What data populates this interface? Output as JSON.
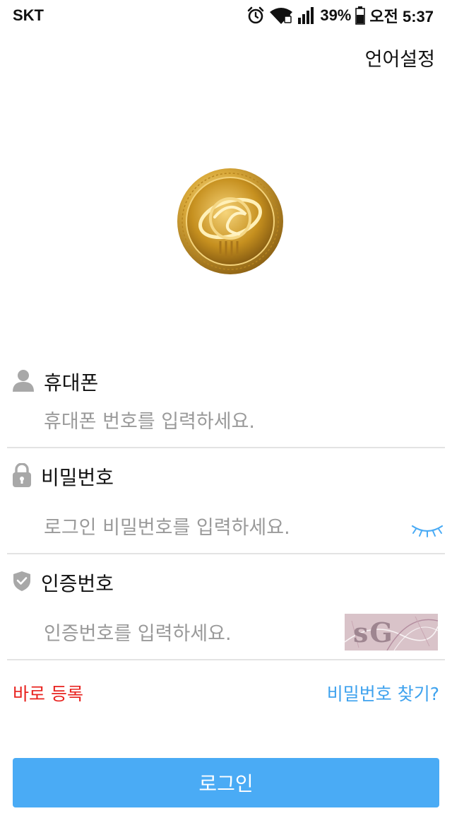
{
  "status_bar": {
    "carrier": "SKT",
    "battery": "39%",
    "time": "오전 5:37",
    "icons": [
      "alarm-icon",
      "wifi-icon",
      "signal-icon",
      "battery-icon"
    ]
  },
  "header": {
    "language_link": "언어설정"
  },
  "logo": {
    "icon": "vpay-coin-logo"
  },
  "form": {
    "phone": {
      "label": "휴대폰",
      "placeholder": "휴대폰 번호를 입력하세요.",
      "value": "",
      "icon": "person-icon"
    },
    "password": {
      "label": "비밀번호",
      "placeholder": "로그인 비밀번호를 입력하세요.",
      "value": "",
      "icon": "lock-icon",
      "toggle_icon": "closed-eye-icon"
    },
    "captcha": {
      "label": "인증번호",
      "placeholder": "인증번호를 입력하세요.",
      "value": "",
      "icon": "shield-check-icon",
      "image_text": "sG"
    }
  },
  "links": {
    "register": "바로 등록",
    "find_password": "비밀번호 찾기?"
  },
  "login_button": "로그인",
  "colors": {
    "accent": "#4aabf5",
    "link_blue": "#3ea2ee",
    "link_red": "#e8231f",
    "icon_gray": "#a8a8a8",
    "divider": "#e3e3e3"
  }
}
